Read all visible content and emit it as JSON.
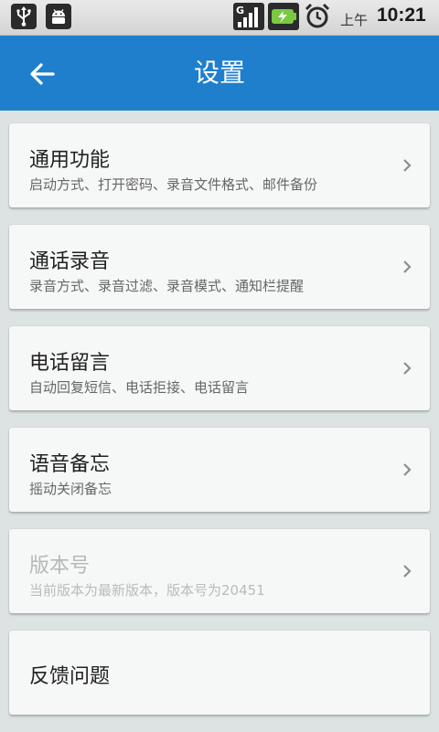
{
  "statusbar": {
    "left_icons": [
      "usb-icon",
      "android-debug-icon"
    ],
    "right_icons": [
      "signal-icon",
      "battery-charging-icon",
      "alarm-icon"
    ],
    "network_type": "G",
    "ampm": "上午",
    "time": "10:21"
  },
  "appbar": {
    "back_icon": "back-arrow-icon",
    "title": "设置",
    "color": "#1f7fcc"
  },
  "settings": {
    "items": [
      {
        "title": "通用功能",
        "subtitle": "启动方式、打开密码、录音文件格式、邮件备份",
        "enabled": true
      },
      {
        "title": "通话录音",
        "subtitle": "录音方式、录音过滤、录音模式、通知栏提醒",
        "enabled": true
      },
      {
        "title": "电话留言",
        "subtitle": "自动回复短信、电话拒接、电话留言",
        "enabled": true
      },
      {
        "title": "语音备忘",
        "subtitle": "摇动关闭备忘",
        "enabled": true
      },
      {
        "title": "版本号",
        "subtitle": "当前版本为最新版本，版本号为20451",
        "enabled": false
      },
      {
        "title": "反馈问题",
        "subtitle": "",
        "enabled": true
      }
    ],
    "chevron_icon": "chevron-right-icon"
  }
}
